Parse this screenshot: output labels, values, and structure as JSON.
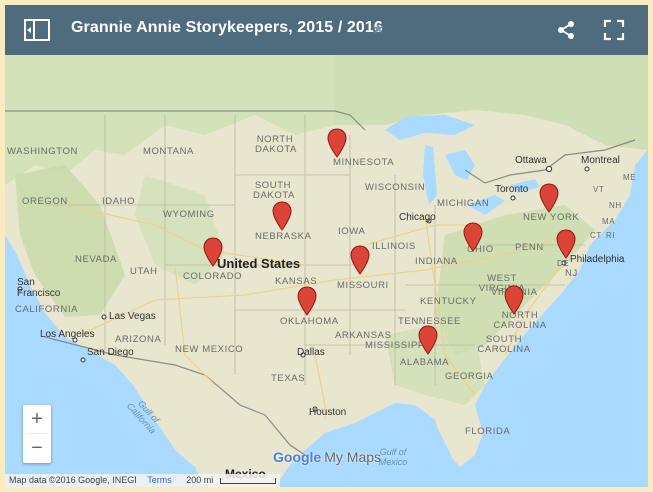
{
  "header": {
    "title": "Grannie Annie Storykeepers, 2015 / 2016",
    "star_icon": "star-icon",
    "share_icon": "share-icon",
    "fullscreen_icon": "fullscreen-icon",
    "sidebar_icon": "sidebar-toggle-icon"
  },
  "map": {
    "country_label": "United States",
    "states": [
      "NORTH DAKOTA",
      "MINNESOTA",
      "SOUTH DAKOTA",
      "WYOMING",
      "NEBRASKA",
      "IOWA",
      "ILLINOIS",
      "WISCONSIN",
      "MICHIGAN",
      "INDIANA",
      "OHIO",
      "PENN",
      "NEW YORK",
      "NJ",
      "DE",
      "WEST VIRGINIA",
      "VIRGINIA",
      "NORTH CAROLINA",
      "SOUTH CAROLINA",
      "KENTUCKY",
      "TENNESSEE",
      "MISSISSIPPI",
      "ALABAMA",
      "GEORGIA",
      "FLORIDA",
      "ARKANSAS",
      "MISSOURI",
      "KANSAS",
      "OKLAHOMA",
      "TEXAS",
      "COLORADO",
      "UTAH",
      "NEVADA",
      "IDAHO",
      "OREGON",
      "WASHINGTON",
      "MONTANA",
      "CALIFORNIA",
      "ARIZONA",
      "NEW MEXICO",
      "VT",
      "NH",
      "MA",
      "CT",
      "RI",
      "ME"
    ],
    "cities": [
      "Ottawa",
      "Montreal",
      "Toronto",
      "Chicago",
      "Philadelphia",
      "San Francisco",
      "Las Vegas",
      "Los Angeles",
      "San Diego",
      "Dallas",
      "Houston",
      "Mexico"
    ],
    "water": [
      "Gulf of California",
      "Gulf of Mexico"
    ],
    "markers_count": 11
  },
  "controls": {
    "zoom_in": "+",
    "zoom_out": "−"
  },
  "footer": {
    "logo_google": "Google",
    "logo_my_maps": "My Maps",
    "attribution": "Map data ©2016 Google, INEGI",
    "terms": "Terms",
    "scale": "200 mi"
  },
  "colors": {
    "header_bg": "#4f6b7e",
    "water": "#aadaff",
    "land": "#e8e4cc",
    "marker": "#db4437"
  }
}
